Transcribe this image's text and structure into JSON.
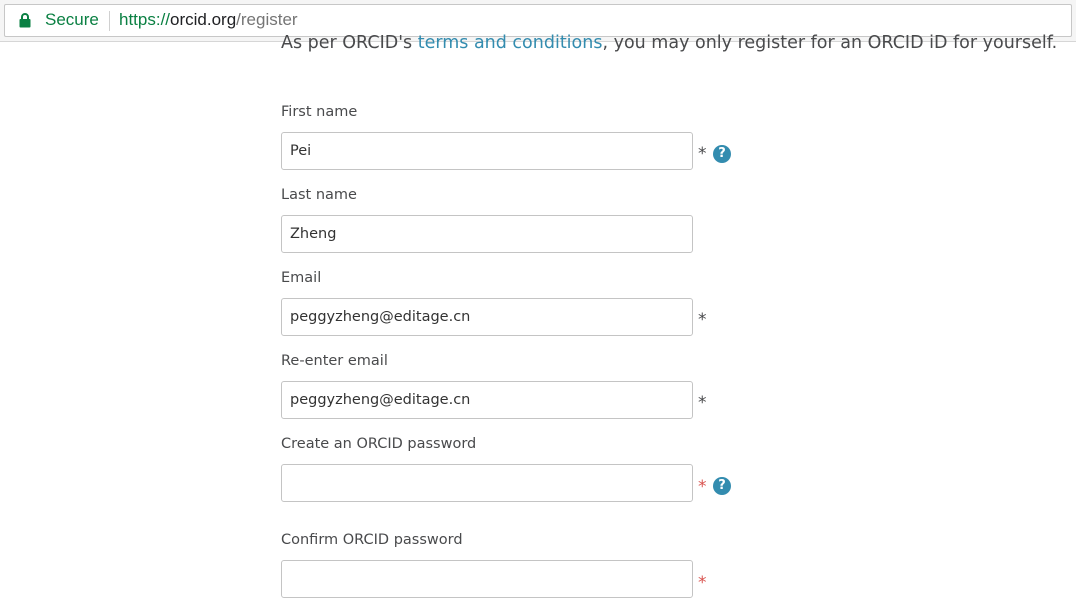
{
  "browser": {
    "secure_label": "Secure",
    "url_scheme": "https://",
    "url_host": "orcid.org",
    "url_path": "/register"
  },
  "intro": {
    "prefix": "As per ORCID's ",
    "link": "terms and conditions",
    "suffix": ", you may only register for an ORCID iD for yourself."
  },
  "form": {
    "first_name": {
      "label": "First name",
      "value": "Pei",
      "required_mark": "*",
      "help_icon": "?"
    },
    "last_name": {
      "label": "Last name",
      "value": "Zheng"
    },
    "email": {
      "label": "Email",
      "value": "peggyzheng@editage.cn",
      "required_mark": "*"
    },
    "reenter_email": {
      "label": "Re-enter email",
      "value": "peggyzheng@editage.cn",
      "required_mark": "*"
    },
    "password": {
      "label": "Create an ORCID password",
      "value": "",
      "required_mark": "*",
      "help_icon": "?"
    },
    "confirm_password": {
      "label": "Confirm ORCID password",
      "value": "",
      "required_mark": "*"
    }
  },
  "colors": {
    "link": "#338caf",
    "secure_green": "#0b8043",
    "required_red": "#d9534f",
    "text": "#494a4c"
  }
}
